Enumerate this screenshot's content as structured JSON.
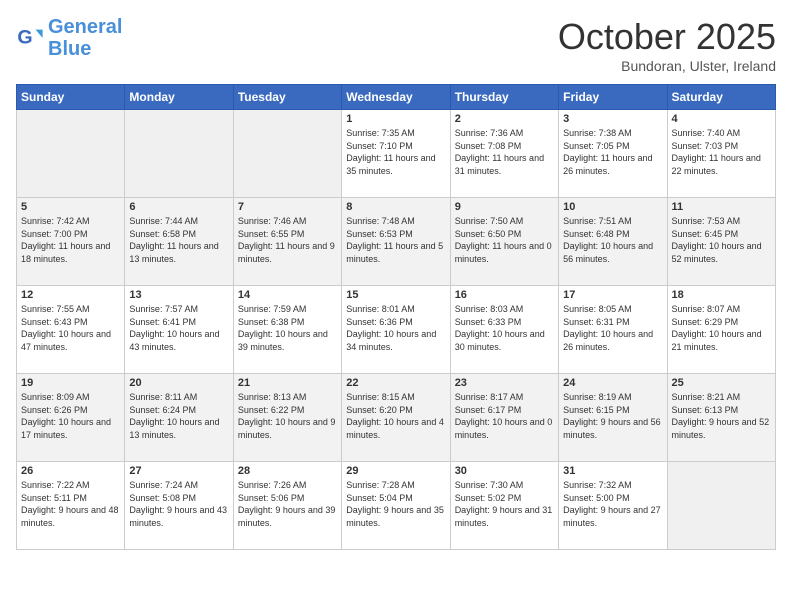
{
  "header": {
    "logo_line1": "General",
    "logo_line2": "Blue",
    "title": "October 2025",
    "location": "Bundoran, Ulster, Ireland"
  },
  "weekdays": [
    "Sunday",
    "Monday",
    "Tuesday",
    "Wednesday",
    "Thursday",
    "Friday",
    "Saturday"
  ],
  "weeks": [
    [
      {
        "day": "",
        "empty": true
      },
      {
        "day": "",
        "empty": true
      },
      {
        "day": "",
        "empty": true
      },
      {
        "day": "1",
        "sunrise": "7:35 AM",
        "sunset": "7:10 PM",
        "daylight": "11 hours and 35 minutes."
      },
      {
        "day": "2",
        "sunrise": "7:36 AM",
        "sunset": "7:08 PM",
        "daylight": "11 hours and 31 minutes."
      },
      {
        "day": "3",
        "sunrise": "7:38 AM",
        "sunset": "7:05 PM",
        "daylight": "11 hours and 26 minutes."
      },
      {
        "day": "4",
        "sunrise": "7:40 AM",
        "sunset": "7:03 PM",
        "daylight": "11 hours and 22 minutes."
      }
    ],
    [
      {
        "day": "5",
        "sunrise": "7:42 AM",
        "sunset": "7:00 PM",
        "daylight": "11 hours and 18 minutes."
      },
      {
        "day": "6",
        "sunrise": "7:44 AM",
        "sunset": "6:58 PM",
        "daylight": "11 hours and 13 minutes."
      },
      {
        "day": "7",
        "sunrise": "7:46 AM",
        "sunset": "6:55 PM",
        "daylight": "11 hours and 9 minutes."
      },
      {
        "day": "8",
        "sunrise": "7:48 AM",
        "sunset": "6:53 PM",
        "daylight": "11 hours and 5 minutes."
      },
      {
        "day": "9",
        "sunrise": "7:50 AM",
        "sunset": "6:50 PM",
        "daylight": "11 hours and 0 minutes."
      },
      {
        "day": "10",
        "sunrise": "7:51 AM",
        "sunset": "6:48 PM",
        "daylight": "10 hours and 56 minutes."
      },
      {
        "day": "11",
        "sunrise": "7:53 AM",
        "sunset": "6:45 PM",
        "daylight": "10 hours and 52 minutes."
      }
    ],
    [
      {
        "day": "12",
        "sunrise": "7:55 AM",
        "sunset": "6:43 PM",
        "daylight": "10 hours and 47 minutes."
      },
      {
        "day": "13",
        "sunrise": "7:57 AM",
        "sunset": "6:41 PM",
        "daylight": "10 hours and 43 minutes."
      },
      {
        "day": "14",
        "sunrise": "7:59 AM",
        "sunset": "6:38 PM",
        "daylight": "10 hours and 39 minutes."
      },
      {
        "day": "15",
        "sunrise": "8:01 AM",
        "sunset": "6:36 PM",
        "daylight": "10 hours and 34 minutes."
      },
      {
        "day": "16",
        "sunrise": "8:03 AM",
        "sunset": "6:33 PM",
        "daylight": "10 hours and 30 minutes."
      },
      {
        "day": "17",
        "sunrise": "8:05 AM",
        "sunset": "6:31 PM",
        "daylight": "10 hours and 26 minutes."
      },
      {
        "day": "18",
        "sunrise": "8:07 AM",
        "sunset": "6:29 PM",
        "daylight": "10 hours and 21 minutes."
      }
    ],
    [
      {
        "day": "19",
        "sunrise": "8:09 AM",
        "sunset": "6:26 PM",
        "daylight": "10 hours and 17 minutes."
      },
      {
        "day": "20",
        "sunrise": "8:11 AM",
        "sunset": "6:24 PM",
        "daylight": "10 hours and 13 minutes."
      },
      {
        "day": "21",
        "sunrise": "8:13 AM",
        "sunset": "6:22 PM",
        "daylight": "10 hours and 9 minutes."
      },
      {
        "day": "22",
        "sunrise": "8:15 AM",
        "sunset": "6:20 PM",
        "daylight": "10 hours and 4 minutes."
      },
      {
        "day": "23",
        "sunrise": "8:17 AM",
        "sunset": "6:17 PM",
        "daylight": "10 hours and 0 minutes."
      },
      {
        "day": "24",
        "sunrise": "8:19 AM",
        "sunset": "6:15 PM",
        "daylight": "9 hours and 56 minutes."
      },
      {
        "day": "25",
        "sunrise": "8:21 AM",
        "sunset": "6:13 PM",
        "daylight": "9 hours and 52 minutes."
      }
    ],
    [
      {
        "day": "26",
        "sunrise": "7:22 AM",
        "sunset": "5:11 PM",
        "daylight": "9 hours and 48 minutes."
      },
      {
        "day": "27",
        "sunrise": "7:24 AM",
        "sunset": "5:08 PM",
        "daylight": "9 hours and 43 minutes."
      },
      {
        "day": "28",
        "sunrise": "7:26 AM",
        "sunset": "5:06 PM",
        "daylight": "9 hours and 39 minutes."
      },
      {
        "day": "29",
        "sunrise": "7:28 AM",
        "sunset": "5:04 PM",
        "daylight": "9 hours and 35 minutes."
      },
      {
        "day": "30",
        "sunrise": "7:30 AM",
        "sunset": "5:02 PM",
        "daylight": "9 hours and 31 minutes."
      },
      {
        "day": "31",
        "sunrise": "7:32 AM",
        "sunset": "5:00 PM",
        "daylight": "9 hours and 27 minutes."
      },
      {
        "day": "",
        "empty": true
      }
    ]
  ]
}
